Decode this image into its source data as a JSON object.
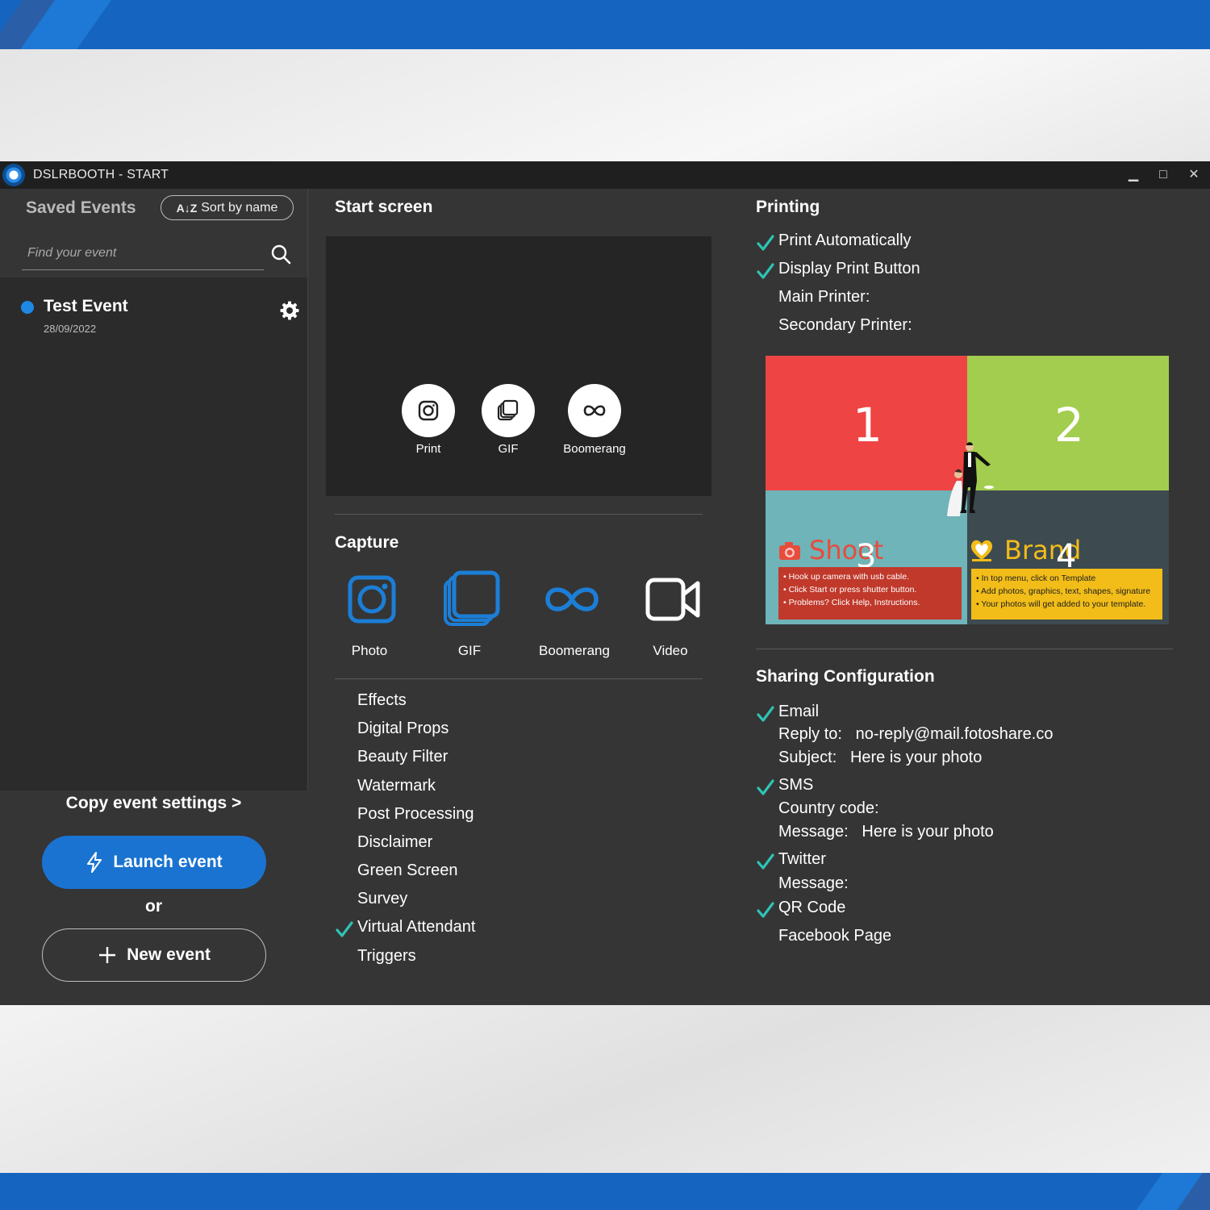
{
  "window": {
    "title": "DSLRBOOTH - START"
  },
  "controls": {
    "minimize": "▁",
    "maximize": "□",
    "close": "✕"
  },
  "sidebar": {
    "heading": "Saved Events",
    "sort_label": "Sort by name",
    "sort_icon_text": "A↓Z",
    "search_placeholder": "Find your event",
    "events": [
      {
        "name": "Test Event",
        "date": "28/09/2022",
        "status_color": "#1e88e5"
      }
    ],
    "copy_settings": "Copy event settings >",
    "launch_label": "Launch event",
    "or_text": "or",
    "new_event_label": "New event"
  },
  "start_screen": {
    "heading": "Start screen",
    "buttons": [
      {
        "label": "Print",
        "icon": "camera-icon"
      },
      {
        "label": "GIF",
        "icon": "gif-stack-icon"
      },
      {
        "label": "Boomerang",
        "icon": "infinity-icon"
      }
    ]
  },
  "capture": {
    "heading": "Capture",
    "modes": [
      {
        "label": "Photo",
        "icon": "camera-icon",
        "active": true
      },
      {
        "label": "GIF",
        "icon": "gif-stack-icon",
        "active": true
      },
      {
        "label": "Boomerang",
        "icon": "infinity-icon",
        "active": true
      },
      {
        "label": "Video",
        "icon": "video-icon",
        "active": false
      }
    ],
    "options": [
      {
        "label": "Effects",
        "checked": false
      },
      {
        "label": "Digital Props",
        "checked": false
      },
      {
        "label": "Beauty Filter",
        "checked": false
      },
      {
        "label": "Watermark",
        "checked": false
      },
      {
        "label": "Post Processing",
        "checked": false
      },
      {
        "label": "Disclaimer",
        "checked": false
      },
      {
        "label": "Green Screen",
        "checked": false
      },
      {
        "label": "Survey",
        "checked": false
      },
      {
        "label": "Virtual Attendant",
        "checked": true
      },
      {
        "label": "Triggers",
        "checked": false
      }
    ]
  },
  "printing": {
    "heading": "Printing",
    "print_automatically": "Print Automatically",
    "display_print_button": "Display Print Button",
    "main_printer": "Main Printer:",
    "secondary_printer": "Secondary Printer:",
    "template": {
      "q1": "1",
      "q2": "2",
      "q3": "3",
      "q4": "4",
      "shoot": "Shoot",
      "brand": "Brand",
      "shoot_notes": [
        "Hook up camera with usb cable.",
        "Click Start or press shutter button.",
        "Problems? Click Help, Instructions."
      ],
      "brand_notes": [
        "In top menu, click on Template",
        "Add photos, graphics, text, shapes, signature",
        "Your photos will get added to your template."
      ],
      "colors": {
        "q1": "#ef4444",
        "q2": "#a3cd4e",
        "q3": "#6fb4b8",
        "q4": "#3d4a50",
        "note_red": "#c0392b",
        "note_yellow": "#f2bd19"
      }
    }
  },
  "sharing": {
    "heading": "Sharing Configuration",
    "email": "Email",
    "reply_to_label": "Reply to:",
    "reply_to_value": "no-reply@mail.fotoshare.co",
    "subject_label": "Subject:",
    "subject_value": "Here is your photo",
    "sms": "SMS",
    "country_code": "Country code:",
    "sms_message_label": "Message:",
    "sms_message_value": "Here is your photo",
    "twitter": "Twitter",
    "twitter_message": "Message:",
    "qr_code": "QR Code",
    "facebook_page": "Facebook Page"
  },
  "theme": {
    "accent": "#1a73d1",
    "check": "#2ec4b6",
    "panel": "#353535",
    "list": "#2b2b2b"
  }
}
